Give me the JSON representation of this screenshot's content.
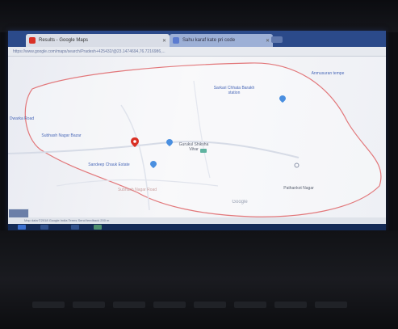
{
  "browser": {
    "tabs": [
      {
        "title": "Results - Google Maps",
        "favicon_color": "#d93025"
      },
      {
        "title": "Sahu karaf kate pri code",
        "favicon_color": "#5b7bd0"
      }
    ],
    "address": "https://www.google.com/maps/search/Pradesh+425432/@23.1474694,76.7216986,..."
  },
  "map": {
    "places": [
      {
        "name": "Anmusuran tempe",
        "kind": "blue"
      },
      {
        "name": "Sarkari Chhata Barakh station"
      },
      {
        "name": "Dwarka Road"
      },
      {
        "name": "Subhash Nagar Bazar"
      },
      {
        "name": "Gurukul Shiksha Vihar",
        "kind": "dark"
      },
      {
        "name": "Pathankot Nagar",
        "kind": "dark"
      },
      {
        "name": "Sandeep Chauk Estate"
      },
      {
        "name": "Google",
        "kind": "watermark"
      }
    ],
    "route_label": "Subhash Nagar Road",
    "status_text": "Map data ©2018 Google   India   Terms   Send feedback   200 m"
  },
  "colors": {
    "boundary": "#e2777a",
    "accent": "#4285f4",
    "pin_red": "#d93025",
    "taskbar": "#142a55"
  }
}
